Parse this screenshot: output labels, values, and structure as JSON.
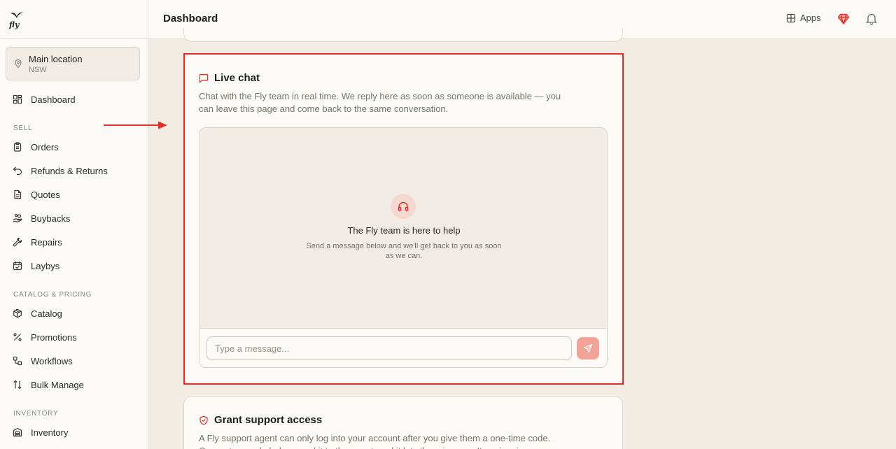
{
  "brand": {
    "name": "Fly",
    "accent": "#d9302a"
  },
  "location": {
    "name": "Main location",
    "region": "NSW"
  },
  "sidebar": {
    "dashboard": {
      "label": "Dashboard",
      "icon": "grid-icon"
    },
    "sections": [
      {
        "heading": "SELL",
        "items": [
          {
            "label": "Orders",
            "icon": "clipboard-icon"
          },
          {
            "label": "Refunds & Returns",
            "icon": "undo-icon"
          },
          {
            "label": "Quotes",
            "icon": "document-icon"
          },
          {
            "label": "Buybacks",
            "icon": "hand-coins-icon"
          },
          {
            "label": "Repairs",
            "icon": "wrench-icon"
          },
          {
            "label": "Laybys",
            "icon": "calendar-check-icon"
          }
        ]
      },
      {
        "heading": "CATALOG & PRICING",
        "items": [
          {
            "label": "Catalog",
            "icon": "box-icon"
          },
          {
            "label": "Promotions",
            "icon": "percent-icon"
          },
          {
            "label": "Workflows",
            "icon": "workflow-icon"
          },
          {
            "label": "Bulk Manage",
            "icon": "arrows-updown-icon"
          }
        ]
      },
      {
        "heading": "INVENTORY",
        "items": [
          {
            "label": "Inventory",
            "icon": "warehouse-icon"
          }
        ]
      }
    ]
  },
  "header": {
    "title": "Dashboard",
    "apps_label": "Apps"
  },
  "live_chat": {
    "title": "Live chat",
    "description": "Chat with the Fly team in real time. We reply here as soon as someone is available — you can leave this page and come back to the same conversation.",
    "empty_title": "The Fly team is here to help",
    "empty_subtitle": "Send a message below and we'll get back to you as soon as we can.",
    "input_placeholder": "Type a message..."
  },
  "grant_access": {
    "title": "Grant support access",
    "description": "A Fly support agent can only log into your account after you give them a one-time code. Generate a code below, read it to the agent, and it lets them in once. It expires in"
  }
}
